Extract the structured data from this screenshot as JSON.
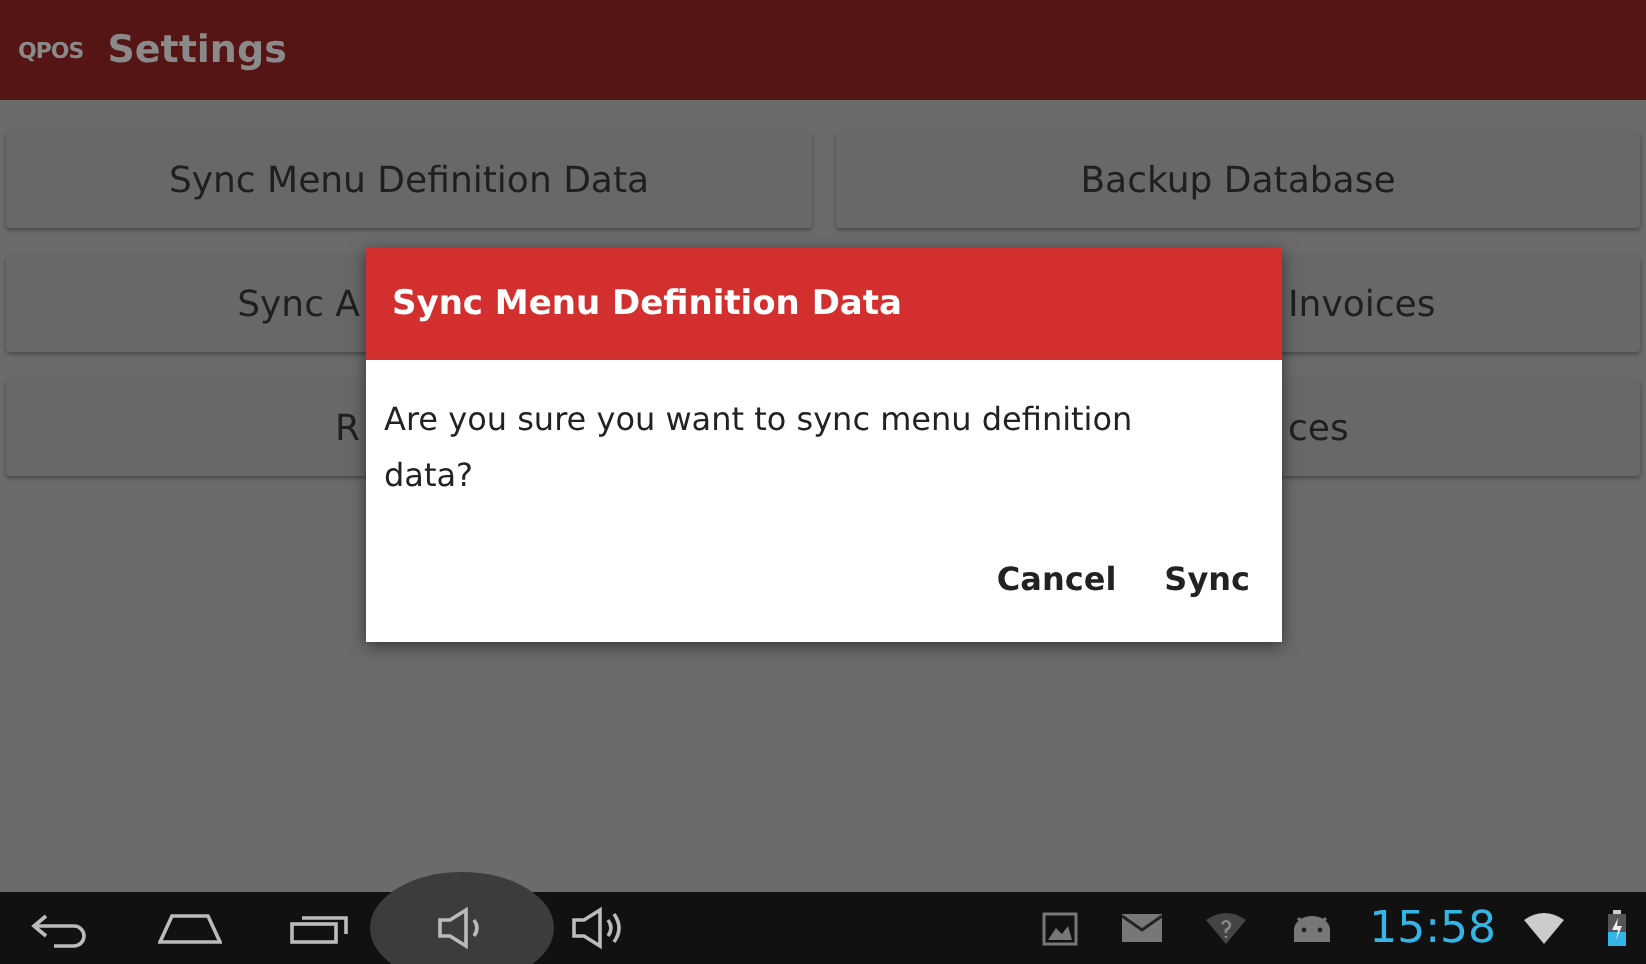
{
  "app_bar": {
    "logo_text": "QPOS",
    "title": "Settings"
  },
  "settings_buttons": [
    {
      "label": "Sync Menu Definition Data",
      "covered": false
    },
    {
      "label": "Backup Database",
      "covered": false
    },
    {
      "label": "Sync A",
      "covered": true
    },
    {
      "label": "Invoices",
      "covered": true
    },
    {
      "label": "R",
      "covered": true
    },
    {
      "label": "ces",
      "covered": true
    }
  ],
  "dialog": {
    "title": "Sync Menu Definition Data",
    "message": "Are you sure you want to sync menu definition data?",
    "buttons": [
      "Cancel",
      "Sync"
    ]
  },
  "system_bar": {
    "clock": "15:58"
  }
}
